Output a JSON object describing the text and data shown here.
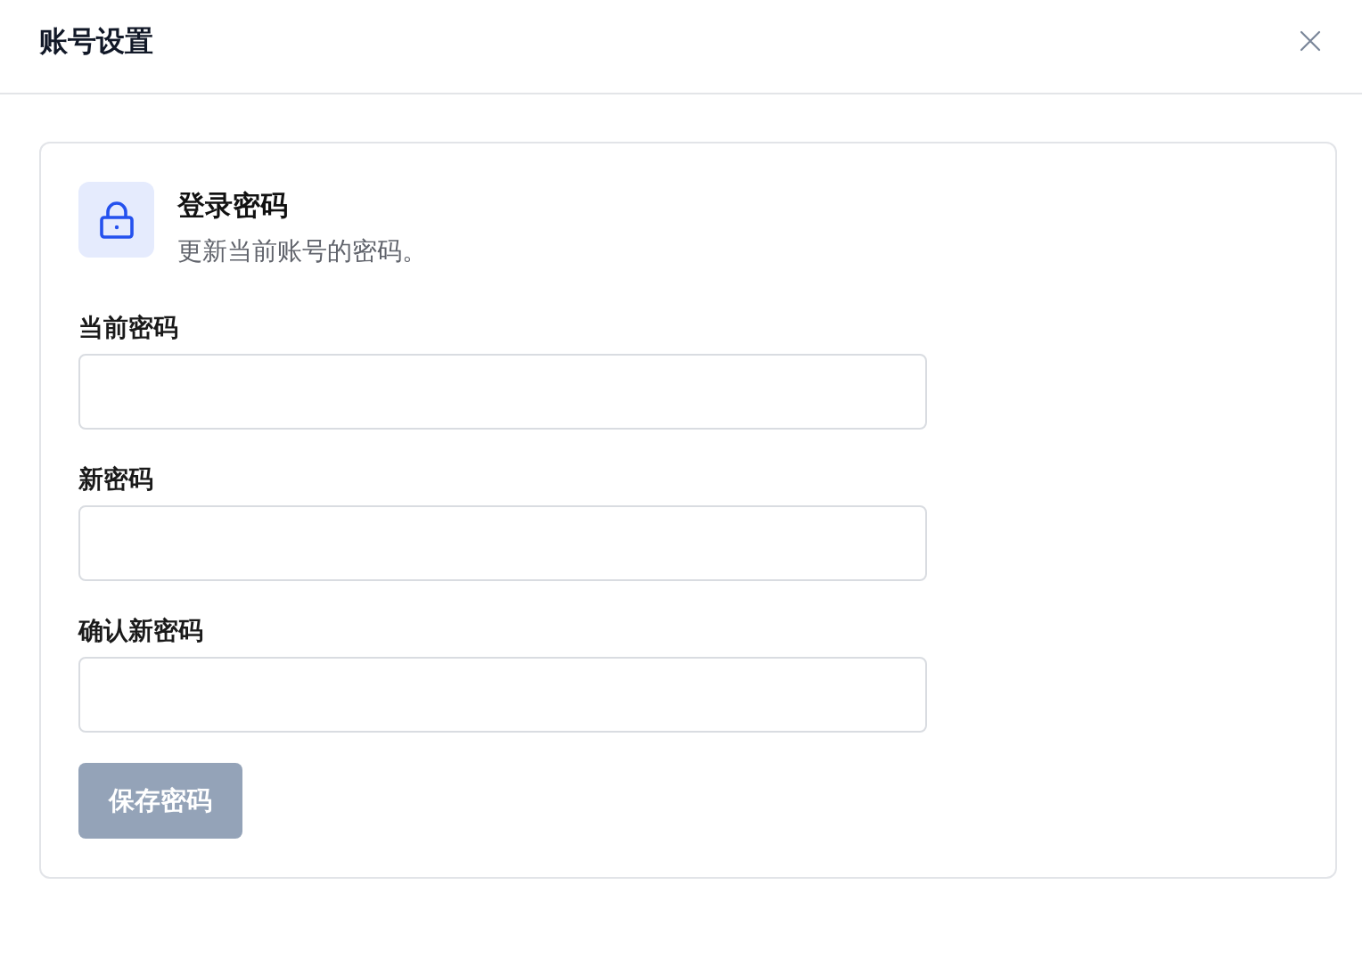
{
  "dialog": {
    "title": "账号设置"
  },
  "section": {
    "title": "登录密码",
    "description": "更新当前账号的密码。"
  },
  "fields": [
    {
      "label": "当前密码"
    },
    {
      "label": "新密码"
    },
    {
      "label": "确认新密码"
    }
  ],
  "save_button": {
    "label": "保存密码",
    "disabled": true
  }
}
